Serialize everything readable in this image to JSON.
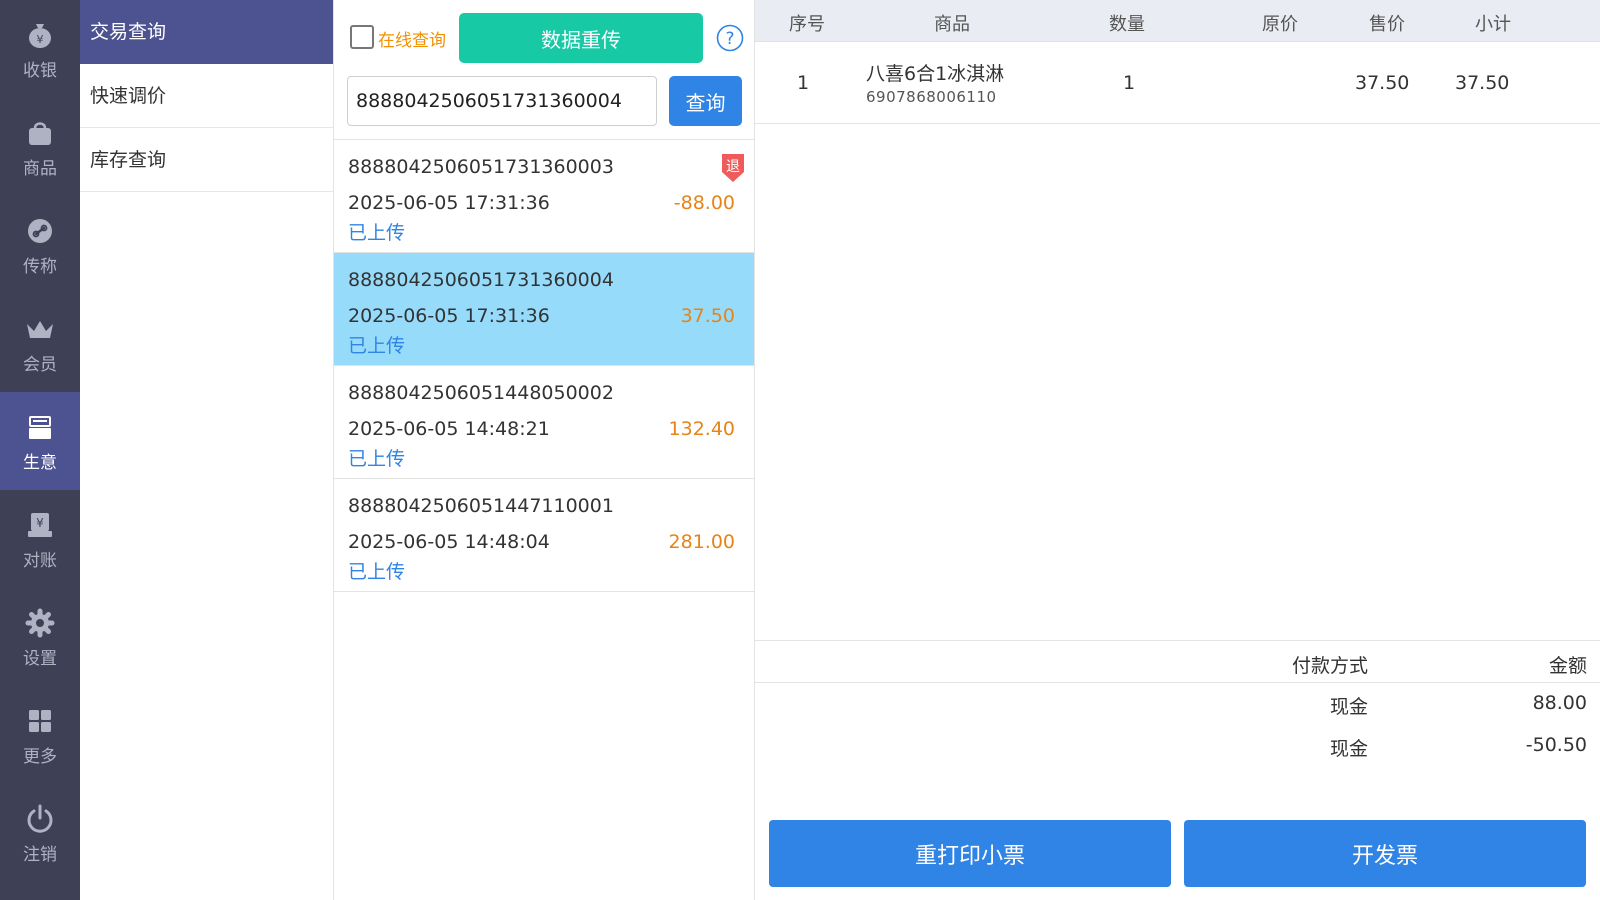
{
  "nav": {
    "items": [
      {
        "label": "收银",
        "icon": "money-bag-icon"
      },
      {
        "label": "商品",
        "icon": "shopping-bag-icon"
      },
      {
        "label": "传称",
        "icon": "scale-link-icon"
      },
      {
        "label": "会员",
        "icon": "crown-icon"
      },
      {
        "label": "生意",
        "icon": "register-icon"
      },
      {
        "label": "对账",
        "icon": "reconcile-icon"
      },
      {
        "label": "设置",
        "icon": "gear-icon"
      },
      {
        "label": "更多",
        "icon": "grid-icon"
      },
      {
        "label": "注销",
        "icon": "power-icon"
      }
    ],
    "active_index": 4,
    "active_color": "#4c5390",
    "bg_color": "#3e4156"
  },
  "submenu": {
    "items": [
      {
        "label": "交易查询"
      },
      {
        "label": "快速调价"
      },
      {
        "label": "库存查询"
      }
    ],
    "active_index": 0
  },
  "toolbar": {
    "online_checked": false,
    "online_label": "在线查询",
    "reupload_label": "数据重传",
    "query_label": "查询",
    "search_value": "8888042506051731360004"
  },
  "transactions": [
    {
      "no": "8888042506051731360003",
      "time": "2025-06-05 17:31:36",
      "amount": "-88.00",
      "status": "已上传",
      "refund_badge": "退",
      "selected": false
    },
    {
      "no": "8888042506051731360004",
      "time": "2025-06-05 17:31:36",
      "amount": "37.50",
      "status": "已上传",
      "selected": true
    },
    {
      "no": "8888042506051448050002",
      "time": "2025-06-05 14:48:21",
      "amount": "132.40",
      "status": "已上传",
      "selected": false
    },
    {
      "no": "8888042506051447110001",
      "time": "2025-06-05 14:48:04",
      "amount": "281.00",
      "status": "已上传",
      "selected": false
    }
  ],
  "detail": {
    "columns": {
      "index": "序号",
      "product": "商品",
      "qty": "数量",
      "orig_price": "原价",
      "sale_price": "售价",
      "subtotal": "小计"
    },
    "items": [
      {
        "index": "1",
        "name": "八喜6合1冰淇淋",
        "barcode": "6907868006110",
        "qty": "1",
        "orig_price": "",
        "sale_price": "37.50",
        "subtotal": "37.50"
      }
    ],
    "payment": {
      "method_header": "付款方式",
      "amount_header": "金额",
      "rows": [
        {
          "method": "现金",
          "amount": "88.00"
        },
        {
          "method": "现金",
          "amount": "-50.50"
        }
      ]
    },
    "reprint_label": "重打印小票",
    "invoice_label": "开发票"
  },
  "colors": {
    "primary_blue": "#2f84e6",
    "teal": "#18c9a6",
    "selected_row": "#97dbfb",
    "amount_orange": "#e78418",
    "refund_red": "#ef5b5b"
  }
}
